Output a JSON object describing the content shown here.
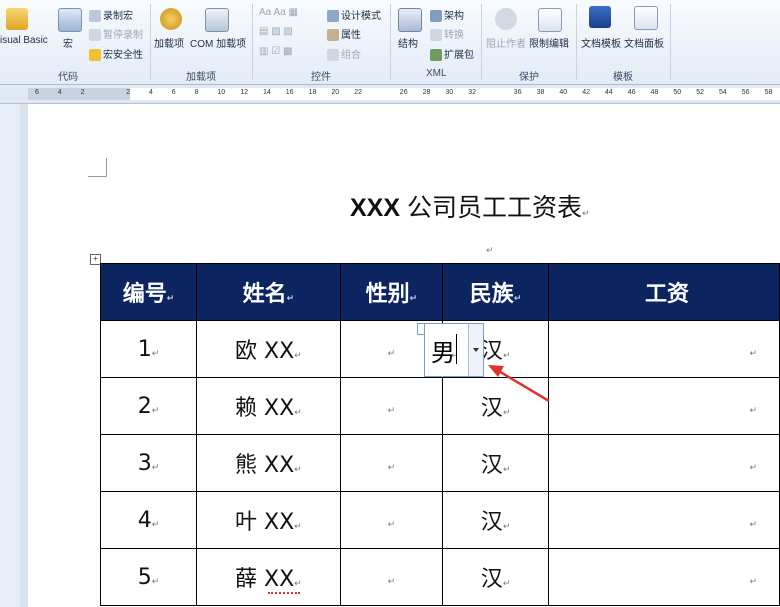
{
  "ribbon": {
    "groups": [
      {
        "label": "代码"
      },
      {
        "label": "加载项"
      },
      {
        "label": "控件"
      },
      {
        "label": "XML"
      },
      {
        "label": "保护"
      },
      {
        "label": "模板"
      }
    ],
    "code": {
      "visual_basic": "isual Basic",
      "macro": "宏",
      "record_macro": "录制宏",
      "pause_recording": "暂停录制",
      "macro_security": "宏安全性"
    },
    "addins": {
      "addins": "加载项",
      "com_addins": "COM 加载项"
    },
    "controls": {
      "design_mode": "设计模式",
      "properties": "属性",
      "group": "组合"
    },
    "xml": {
      "structure": "结构",
      "schema": "架构",
      "transform": "转换",
      "expansion_pack": "扩展包"
    },
    "protect": {
      "block_authors": "阻止作者",
      "restrict_editing": "限制编辑"
    },
    "templates": {
      "doc_template": "文档模板",
      "doc_panel": "文档面板"
    }
  },
  "ruler": {
    "ticks": [
      "6",
      "4",
      "2",
      "",
      "2",
      "4",
      "6",
      "8",
      "10",
      "12",
      "14",
      "16",
      "18",
      "20",
      "22",
      "",
      "26",
      "28",
      "30",
      "32",
      "",
      "36",
      "38",
      "40",
      "42",
      "44",
      "46",
      "48",
      "50",
      "52",
      "54",
      "56",
      "58"
    ]
  },
  "document": {
    "title_bold": "XXX",
    "title_rest": " 公司员工工资表",
    "table": {
      "headers": [
        "编号",
        "姓名",
        "性别",
        "民族",
        "工资"
      ],
      "rows": [
        {
          "num": "1",
          "name": "欧 XX",
          "gender": "",
          "ethnic": "汉"
        },
        {
          "num": "2",
          "name": "赖 XX",
          "gender": "",
          "ethnic": "汉"
        },
        {
          "num": "3",
          "name": "熊 XX",
          "gender": "",
          "ethnic": "汉"
        },
        {
          "num": "4",
          "name": "叶 XX",
          "gender": "",
          "ethnic": "汉"
        },
        {
          "num": "5",
          "name": "薛 XX",
          "gender": "",
          "ethnic": "汉"
        }
      ]
    },
    "dropdown": {
      "value": "男"
    },
    "para_mark": "↵",
    "table_handle": "+"
  },
  "colors": {
    "header_bg": "#0c2561",
    "arrow": "#e0332b"
  }
}
